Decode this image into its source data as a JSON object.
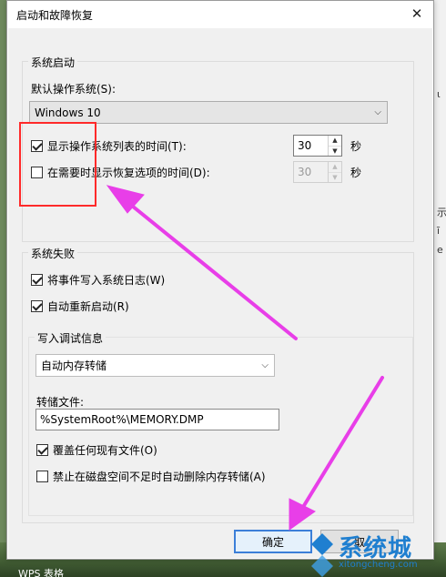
{
  "window": {
    "title": "启动和故障恢复"
  },
  "startup": {
    "group_label": "系统启动",
    "default_os_label": "默认操作系统(S):",
    "default_os_value": "Windows 10",
    "show_list_label": "显示操作系统列表的时间(T):",
    "show_list_checked": true,
    "show_list_value": "30",
    "show_recovery_label": "在需要时显示恢复选项的时间(D):",
    "show_recovery_checked": false,
    "show_recovery_value": "30",
    "seconds_unit": "秒"
  },
  "failure": {
    "group_label": "系统失败",
    "write_event_label": "将事件写入系统日志(W)",
    "write_event_checked": true,
    "auto_restart_label": "自动重新启动(R)",
    "auto_restart_checked": true,
    "debug": {
      "group_label": "写入调试信息",
      "dump_type_value": "自动内存转储",
      "dump_file_label": "转储文件:",
      "dump_file_value": "%SystemRoot%\\MEMORY.DMP",
      "overwrite_label": "覆盖任何现有文件(O)",
      "overwrite_checked": true,
      "disable_autodelete_label": "禁止在磁盘空间不足时自动删除内存转储(A)",
      "disable_autodelete_checked": false
    }
  },
  "buttons": {
    "ok_label": "确定",
    "cancel_label": "取"
  },
  "background": {
    "taskbar_text": "WPS 表格",
    "side_chars": [
      "ι",
      "示",
      "ī",
      "e"
    ]
  },
  "watermark": {
    "name": "系统城",
    "url": "xitongcheng.com"
  },
  "colors": {
    "annotation_red": "#ff2a2a",
    "annotation_arrow": "#e83ee8",
    "primary_border": "#3c7fd8"
  }
}
